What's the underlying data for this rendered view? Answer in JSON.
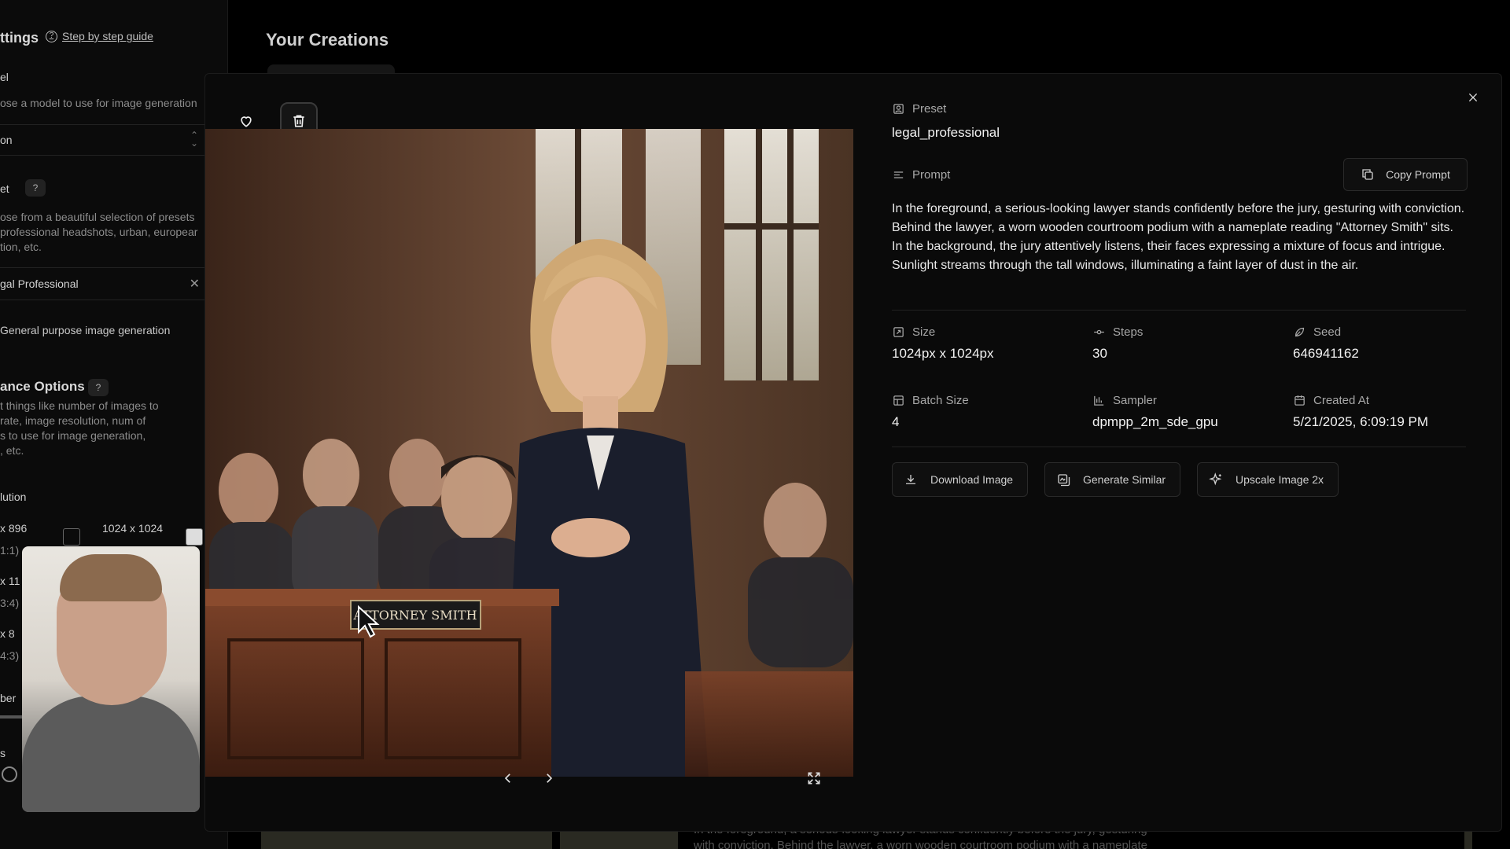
{
  "sidebar": {
    "title": "ttings",
    "guide_link": "Step by step guide",
    "model_label": "el",
    "model_desc": "ose a model to use for image generation",
    "model_value": "on",
    "preset_label": "et",
    "help_badge": "?",
    "preset_desc_1": "ose from a beautiful selection of presets",
    "preset_desc_2": "professional headshots, urban, europear",
    "preset_desc_3": "tion, etc.",
    "preset_value": "gal Professional",
    "preset_sub": "General purpose image generation",
    "advance_title": "ance Options",
    "advance_desc_1": "t things like number of images to",
    "advance_desc_2": "rate, image resolution, num of",
    "advance_desc_3": "s to use for image generation,",
    "advance_desc_4": ", etc.",
    "resolution_label": "lution",
    "res_a": "x 896",
    "res_a_ratio": "1:1)",
    "res_b": "1024 x 1024",
    "res_c": "x 11",
    "res_c_ratio": "3:4)",
    "res_d": "x 8",
    "res_d_ratio": "4:3)",
    "number_label": "ber",
    "steps_label": "s"
  },
  "main": {
    "title": "Your Creations",
    "bottom_text_1": "In the foreground, a serious-looking lawyer stands confidently before the jury, gesturing",
    "bottom_text_2": "with conviction. Behind the lawyer, a worn wooden courtroom podium with a nameplate"
  },
  "modal": {
    "image_alt": "Generated image of a lawyer standing in a courtroom",
    "nameplate": "ATTORNEY SMITH",
    "preset_label": "Preset",
    "preset_value": "legal_professional",
    "prompt_label": "Prompt",
    "copy_prompt": "Copy Prompt",
    "prompt_text": "In the foreground, a serious-looking lawyer stands confidently before the jury, gesturing with conviction. Behind the lawyer, a worn wooden courtroom podium with a nameplate reading \"Attorney Smith\" sits. In the background, the jury attentively listens, their faces expressing a mixture of focus and intrigue. Sunlight streams through the tall windows, illuminating a faint layer of dust in the air.",
    "meta": {
      "size_label": "Size",
      "size_value": "1024px x 1024px",
      "steps_label": "Steps",
      "steps_value": "30",
      "seed_label": "Seed",
      "seed_value": "646941162",
      "batch_label": "Batch Size",
      "batch_value": "4",
      "sampler_label": "Sampler",
      "sampler_value": "dpmpp_2m_sde_gpu",
      "created_label": "Created At",
      "created_value": "5/21/2025, 6:09:19 PM"
    },
    "actions": {
      "download": "Download Image",
      "similar": "Generate Similar",
      "upscale": "Upscale Image 2x"
    }
  },
  "icons": [
    "heart-icon",
    "trash-icon",
    "chevron-left-icon",
    "chevron-right-icon",
    "expand-icon",
    "close-icon",
    "preset-icon",
    "prompt-icon",
    "copy-icon",
    "size-icon",
    "steps-icon",
    "seed-icon",
    "batch-icon",
    "sampler-icon",
    "calendar-icon",
    "download-icon",
    "similar-icon",
    "sparkle-icon"
  ]
}
